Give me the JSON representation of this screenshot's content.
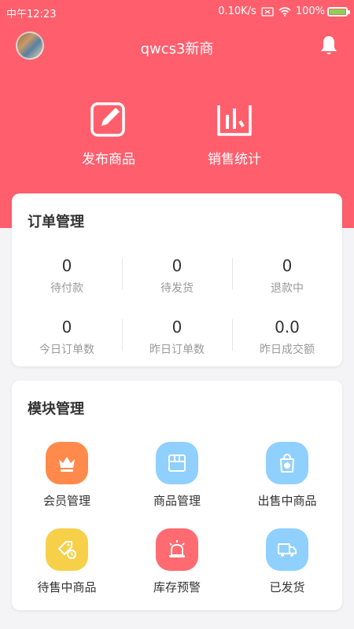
{
  "status_bar": {
    "time": "中午12:23",
    "speed": "0.10K/s",
    "battery": "100%"
  },
  "header": {
    "title": "qwcs3新商",
    "avatar_icon": "avatar-image",
    "bell_icon": "bell-icon"
  },
  "quick_actions": [
    {
      "label": "发布商品",
      "icon": "edit-icon"
    },
    {
      "label": "销售统计",
      "icon": "bar-chart-icon"
    }
  ],
  "orders": {
    "title": "订单管理",
    "stats": [
      {
        "value": "0",
        "label": "待付款"
      },
      {
        "value": "0",
        "label": "待发货"
      },
      {
        "value": "0",
        "label": "退款中"
      },
      {
        "value": "0",
        "label": "今日订单数"
      },
      {
        "value": "0",
        "label": "昨日订单数"
      },
      {
        "value": "0.0",
        "label": "昨日成交额"
      }
    ]
  },
  "modules": {
    "title": "模块管理",
    "items": [
      {
        "label": "会员管理",
        "icon": "crown-icon",
        "color": "#ff8a4c"
      },
      {
        "label": "商品管理",
        "icon": "box-icon",
        "color": "#8fd0ff"
      },
      {
        "label": "出售中商品",
        "icon": "shopping-bag-icon",
        "color": "#8fd0ff"
      },
      {
        "label": "待售中商品",
        "icon": "tag-clock-icon",
        "color": "#f7d04a"
      },
      {
        "label": "库存预警",
        "icon": "alarm-icon",
        "color": "#ff6b70"
      },
      {
        "label": "已发货",
        "icon": "truck-icon",
        "color": "#8fd0ff"
      }
    ]
  },
  "colors": {
    "accent": "#ff5f6d"
  }
}
